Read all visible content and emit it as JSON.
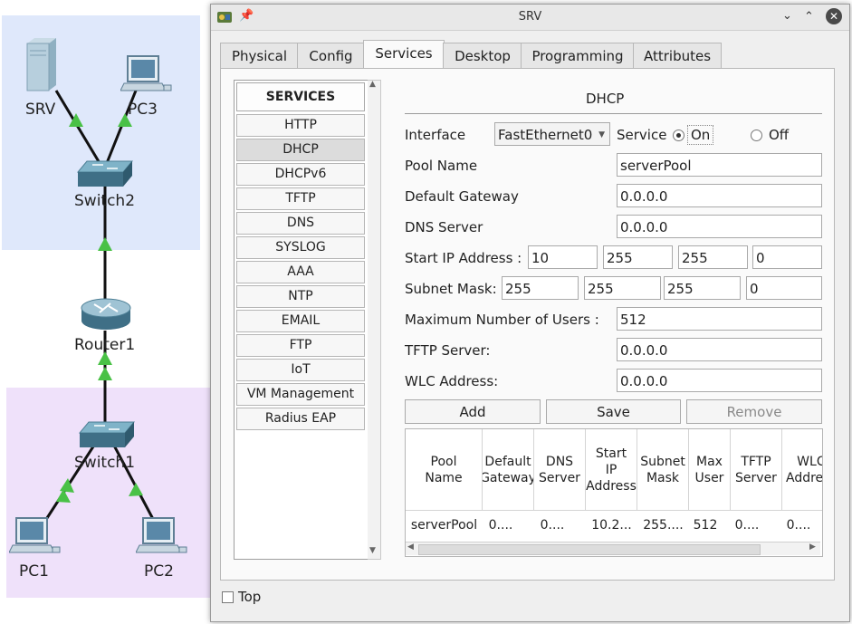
{
  "topology": {
    "devices": [
      {
        "label": "SRV",
        "type": "server"
      },
      {
        "label": "PC3",
        "type": "pc"
      },
      {
        "label": "Switch2",
        "type": "switch"
      },
      {
        "label": "Router1",
        "type": "router"
      },
      {
        "label": "Switch1",
        "type": "switch"
      },
      {
        "label": "PC1",
        "type": "pc"
      },
      {
        "label": "PC2",
        "type": "pc"
      }
    ],
    "link_status_color": "#49c146",
    "zone_top_color": "#dfe8fb",
    "zone_bottom_color": "#efe1fa"
  },
  "window": {
    "title": "SRV",
    "tabs": [
      "Physical",
      "Config",
      "Services",
      "Desktop",
      "Programming",
      "Attributes"
    ],
    "active_tab": "Services",
    "top_checkbox_label": "Top"
  },
  "services": {
    "header": "SERVICES",
    "items": [
      "HTTP",
      "DHCP",
      "DHCPv6",
      "TFTP",
      "DNS",
      "SYSLOG",
      "AAA",
      "NTP",
      "EMAIL",
      "FTP",
      "IoT",
      "VM Management",
      "Radius EAP"
    ],
    "selected": "DHCP"
  },
  "dhcp": {
    "title": "DHCP",
    "interface_label": "Interface",
    "interface_value": "FastEthernet0",
    "service_label": "Service",
    "on_label": "On",
    "off_label": "Off",
    "service_state": "On",
    "pool_name_label": "Pool Name",
    "pool_name": "serverPool",
    "default_gateway_label": "Default Gateway",
    "default_gateway": "0.0.0.0",
    "dns_server_label": "DNS Server",
    "dns_server": "0.0.0.0",
    "start_ip_label": "Start IP Address :",
    "start_ip": [
      "10",
      "255",
      "255",
      "0"
    ],
    "subnet_mask_label": "Subnet Mask:",
    "subnet_mask": [
      "255",
      "255",
      "255",
      "0"
    ],
    "max_users_label": "Maximum Number of Users :",
    "max_users": "512",
    "tftp_server_label": "TFTP Server:",
    "tftp_server": "0.0.0.0",
    "wlc_address_label": "WLC Address:",
    "wlc_address": "0.0.0.0",
    "add_label": "Add",
    "save_label": "Save",
    "remove_label": "Remove",
    "table": {
      "headers": [
        "Pool\nName",
        "Default\nGateway",
        "DNS\nServer",
        "Start\nIP\nAddress",
        "Subnet\nMask",
        "Max\nUser",
        "TFTP\nServer",
        "WLC\nAddress"
      ],
      "rows": [
        [
          "serverPool",
          "0....",
          "0....",
          "10.2...",
          "255....",
          "512",
          "0....",
          "0...."
        ]
      ]
    }
  }
}
